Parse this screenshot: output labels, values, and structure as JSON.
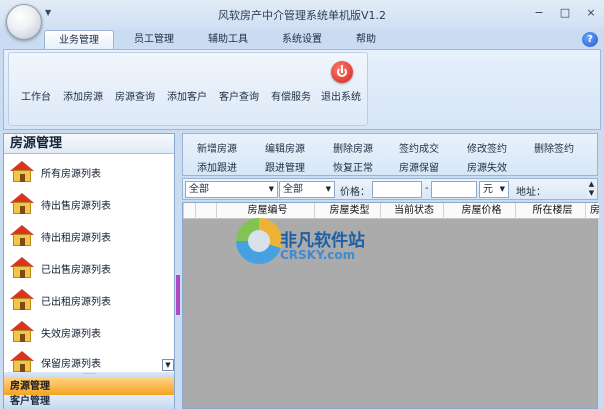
{
  "window": {
    "title": "风软房产中介管理系统单机版V1.2",
    "controls": {
      "minimize": "−",
      "restore": "□",
      "close": "×"
    }
  },
  "ribbon": {
    "tabs": [
      {
        "label": "业务管理",
        "active": true
      },
      {
        "label": "员工管理",
        "active": false
      },
      {
        "label": "辅助工具",
        "active": false
      },
      {
        "label": "系统设置",
        "active": false
      },
      {
        "label": "帮助",
        "active": false
      }
    ],
    "help_icon": "?",
    "items": [
      "工作台",
      "添加房源",
      "房源查询",
      "添加客户",
      "客户查询",
      "有偿服务",
      "退出系统"
    ],
    "exit_icon": "power-icon"
  },
  "sidebar": {
    "title": "房源管理",
    "items": [
      "所有房源列表",
      "待出售房源列表",
      "待出租房源列表",
      "已出售房源列表",
      "已出租房源列表",
      "失效房源列表",
      "保留房源列表"
    ],
    "item_icon": "house-icon",
    "nav": {
      "active": "房源管理",
      "next": "客户管理"
    }
  },
  "actions": {
    "row1": [
      "新增房源",
      "编辑房源",
      "删除房源",
      "签约成交",
      "修改签约",
      "删除签约"
    ],
    "row2": [
      "添加跟进",
      "跟进管理",
      "恢复正常",
      "房源保留",
      "房源失效"
    ]
  },
  "filters": {
    "select1": "全部",
    "select2": "全部",
    "price_label": "价格：",
    "dash": "-",
    "unit": "元",
    "address_label": "地址："
  },
  "grid": {
    "columns": [
      "房屋编号",
      "房屋类型",
      "当前状态",
      "房屋价格",
      "所在楼层",
      "房"
    ]
  },
  "watermark": {
    "cn": "非凡软件站",
    "en": "CRSKY.com"
  },
  "colors": {
    "accent_nav": "#f6a323",
    "splitter": "#b048c6",
    "exit": "#d3231a"
  }
}
